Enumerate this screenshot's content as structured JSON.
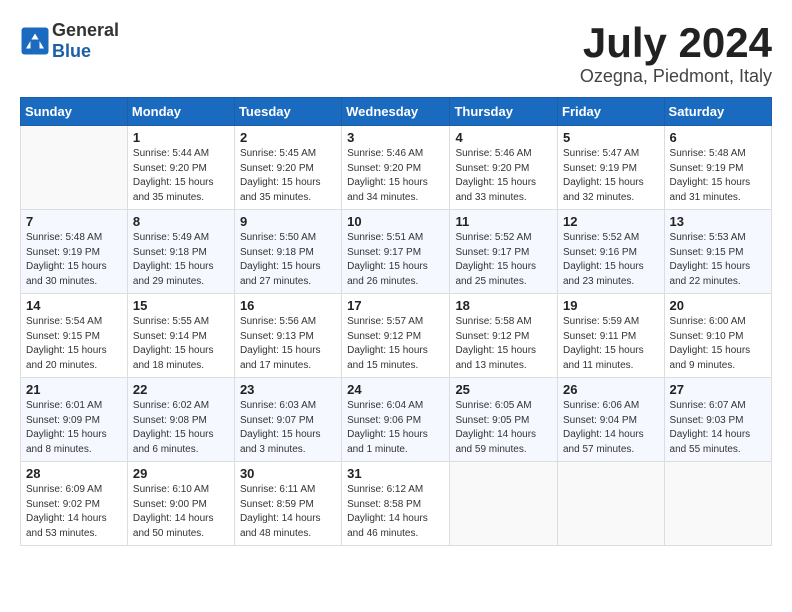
{
  "header": {
    "logo_general": "General",
    "logo_blue": "Blue",
    "month_year": "July 2024",
    "location": "Ozegna, Piedmont, Italy"
  },
  "days_of_week": [
    "Sunday",
    "Monday",
    "Tuesday",
    "Wednesday",
    "Thursday",
    "Friday",
    "Saturday"
  ],
  "weeks": [
    [
      {
        "day": "",
        "info": ""
      },
      {
        "day": "1",
        "info": "Sunrise: 5:44 AM\nSunset: 9:20 PM\nDaylight: 15 hours\nand 35 minutes."
      },
      {
        "day": "2",
        "info": "Sunrise: 5:45 AM\nSunset: 9:20 PM\nDaylight: 15 hours\nand 35 minutes."
      },
      {
        "day": "3",
        "info": "Sunrise: 5:46 AM\nSunset: 9:20 PM\nDaylight: 15 hours\nand 34 minutes."
      },
      {
        "day": "4",
        "info": "Sunrise: 5:46 AM\nSunset: 9:20 PM\nDaylight: 15 hours\nand 33 minutes."
      },
      {
        "day": "5",
        "info": "Sunrise: 5:47 AM\nSunset: 9:19 PM\nDaylight: 15 hours\nand 32 minutes."
      },
      {
        "day": "6",
        "info": "Sunrise: 5:48 AM\nSunset: 9:19 PM\nDaylight: 15 hours\nand 31 minutes."
      }
    ],
    [
      {
        "day": "7",
        "info": "Sunrise: 5:48 AM\nSunset: 9:19 PM\nDaylight: 15 hours\nand 30 minutes."
      },
      {
        "day": "8",
        "info": "Sunrise: 5:49 AM\nSunset: 9:18 PM\nDaylight: 15 hours\nand 29 minutes."
      },
      {
        "day": "9",
        "info": "Sunrise: 5:50 AM\nSunset: 9:18 PM\nDaylight: 15 hours\nand 27 minutes."
      },
      {
        "day": "10",
        "info": "Sunrise: 5:51 AM\nSunset: 9:17 PM\nDaylight: 15 hours\nand 26 minutes."
      },
      {
        "day": "11",
        "info": "Sunrise: 5:52 AM\nSunset: 9:17 PM\nDaylight: 15 hours\nand 25 minutes."
      },
      {
        "day": "12",
        "info": "Sunrise: 5:52 AM\nSunset: 9:16 PM\nDaylight: 15 hours\nand 23 minutes."
      },
      {
        "day": "13",
        "info": "Sunrise: 5:53 AM\nSunset: 9:15 PM\nDaylight: 15 hours\nand 22 minutes."
      }
    ],
    [
      {
        "day": "14",
        "info": "Sunrise: 5:54 AM\nSunset: 9:15 PM\nDaylight: 15 hours\nand 20 minutes."
      },
      {
        "day": "15",
        "info": "Sunrise: 5:55 AM\nSunset: 9:14 PM\nDaylight: 15 hours\nand 18 minutes."
      },
      {
        "day": "16",
        "info": "Sunrise: 5:56 AM\nSunset: 9:13 PM\nDaylight: 15 hours\nand 17 minutes."
      },
      {
        "day": "17",
        "info": "Sunrise: 5:57 AM\nSunset: 9:12 PM\nDaylight: 15 hours\nand 15 minutes."
      },
      {
        "day": "18",
        "info": "Sunrise: 5:58 AM\nSunset: 9:12 PM\nDaylight: 15 hours\nand 13 minutes."
      },
      {
        "day": "19",
        "info": "Sunrise: 5:59 AM\nSunset: 9:11 PM\nDaylight: 15 hours\nand 11 minutes."
      },
      {
        "day": "20",
        "info": "Sunrise: 6:00 AM\nSunset: 9:10 PM\nDaylight: 15 hours\nand 9 minutes."
      }
    ],
    [
      {
        "day": "21",
        "info": "Sunrise: 6:01 AM\nSunset: 9:09 PM\nDaylight: 15 hours\nand 8 minutes."
      },
      {
        "day": "22",
        "info": "Sunrise: 6:02 AM\nSunset: 9:08 PM\nDaylight: 15 hours\nand 6 minutes."
      },
      {
        "day": "23",
        "info": "Sunrise: 6:03 AM\nSunset: 9:07 PM\nDaylight: 15 hours\nand 3 minutes."
      },
      {
        "day": "24",
        "info": "Sunrise: 6:04 AM\nSunset: 9:06 PM\nDaylight: 15 hours\nand 1 minute."
      },
      {
        "day": "25",
        "info": "Sunrise: 6:05 AM\nSunset: 9:05 PM\nDaylight: 14 hours\nand 59 minutes."
      },
      {
        "day": "26",
        "info": "Sunrise: 6:06 AM\nSunset: 9:04 PM\nDaylight: 14 hours\nand 57 minutes."
      },
      {
        "day": "27",
        "info": "Sunrise: 6:07 AM\nSunset: 9:03 PM\nDaylight: 14 hours\nand 55 minutes."
      }
    ],
    [
      {
        "day": "28",
        "info": "Sunrise: 6:09 AM\nSunset: 9:02 PM\nDaylight: 14 hours\nand 53 minutes."
      },
      {
        "day": "29",
        "info": "Sunrise: 6:10 AM\nSunset: 9:00 PM\nDaylight: 14 hours\nand 50 minutes."
      },
      {
        "day": "30",
        "info": "Sunrise: 6:11 AM\nSunset: 8:59 PM\nDaylight: 14 hours\nand 48 minutes."
      },
      {
        "day": "31",
        "info": "Sunrise: 6:12 AM\nSunset: 8:58 PM\nDaylight: 14 hours\nand 46 minutes."
      },
      {
        "day": "",
        "info": ""
      },
      {
        "day": "",
        "info": ""
      },
      {
        "day": "",
        "info": ""
      }
    ]
  ]
}
